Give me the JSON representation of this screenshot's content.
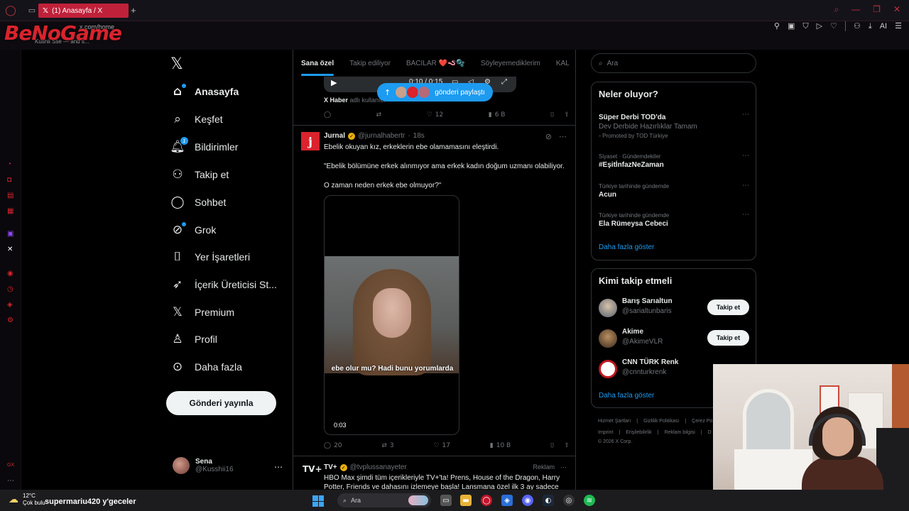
{
  "browser": {
    "tab_title": "(1) Anasayfa / X",
    "new_tab": "+",
    "url": "x.com/home",
    "url_sub": "Kusnii Sse — and s...",
    "watermark": "BeNoGame",
    "tools_ai": "AI"
  },
  "nav": {
    "home": "Anasayfa",
    "explore": "Keşfet",
    "notifications": "Bildirimler",
    "notifications_badge": "1",
    "follow": "Takip et",
    "chat": "Sohbet",
    "grok": "Grok",
    "bookmarks": "Yer İşaretleri",
    "creator_studio": "İçerik Üreticisi St...",
    "premium": "Premium",
    "profile": "Profil",
    "more": "Daha fazla",
    "post_button": "Gönderi yayınla",
    "user_name": "Sena",
    "user_handle": "@Kusshii16"
  },
  "timeline": {
    "tabs": [
      "Sana özel",
      "Takip ediliyor",
      "BACILAR ❤️🪱🫧",
      "Söyleyemediklerim",
      "KAL"
    ],
    "tweet1": {
      "video_time": "0:10 / 0:15",
      "share_pill": "gönderi paylaştı",
      "source_name": "X Haber",
      "source_rest": "adlı kullanıcı",
      "likes": "12",
      "views": "6 B"
    },
    "tweet2": {
      "avatar_letter": "j",
      "name": "Jurnal",
      "handle": "@jurnalhabertr",
      "time": "18s",
      "line1": "Ebelik okuyan kız, erkeklerin ebe olamamasını eleştirdi.",
      "line2": "\"Ebelik bölümüne erkek alınmıyor ama erkek kadın doğum uzmanı olabiliyor.",
      "line3": "O zaman neden erkek ebe olmuyor?\"",
      "caption": "ebe olur mu? Hadi bunu yorumlarda",
      "video_time": "0:03",
      "replies": "20",
      "reposts": "3",
      "likes": "17",
      "views": "10 B"
    },
    "tweet3": {
      "avatar": "TV+",
      "name": "TV+",
      "handle": "@tvplussanayeter",
      "ad_label": "Reklam",
      "text": "HBO Max şimdi tüm içerikleriyle TV+'ta! Prens, House of the Dragon, Harry Potter, Friends ve dahasını izlemeye başla! Lansmana özel ilk 3 ay sadece"
    }
  },
  "sidebar": {
    "search_placeholder": "Ara",
    "trends_title": "Neler oluyor?",
    "trends": [
      {
        "cat": "",
        "name": "Süper Derbi TOD'da",
        "sub": "Dev Derbide Hazırlıklar Tamam",
        "promo": "Promoted by TOD Türkiye"
      },
      {
        "cat": "Siyaset · Gündemdekiler",
        "name": "#EşitİnfazNeZaman",
        "sub": "",
        "promo": ""
      },
      {
        "cat": "Türkiye tarihinde gündemde",
        "name": "Acun",
        "sub": "",
        "promo": ""
      },
      {
        "cat": "Türkiye tarihinde gündemde",
        "name": "Ela Rümeysa Cebeci",
        "sub": "",
        "promo": ""
      }
    ],
    "show_more": "Daha fazla göster",
    "who_title": "Kimi takip etmeli",
    "who": [
      {
        "name": "Barış Sarıaltun",
        "handle": "@sarialtunbaris",
        "button": "Takip et"
      },
      {
        "name": "Akime",
        "handle": "@AkimeVLR",
        "button": "Takip et"
      },
      {
        "name": "CNN TÜRK Renk",
        "handle": "@cnnturkrenk",
        "button": ""
      }
    ],
    "who_more": "Daha fazla göster",
    "footer1": [
      "Hizmet Şartları",
      "|",
      "Gizlilik Politikası",
      "|",
      "Çerez Po"
    ],
    "footer2": [
      "Imprint",
      "|",
      "Erişilebilirlik",
      "|",
      "Reklam bilgisi",
      "|",
      "D"
    ],
    "copyright": "© 2026 X Corp."
  },
  "taskbar": {
    "temp": "12°C",
    "weather": "Çok bulu",
    "ticker": "supermariu420  y'geceler",
    "search": "Ara"
  }
}
